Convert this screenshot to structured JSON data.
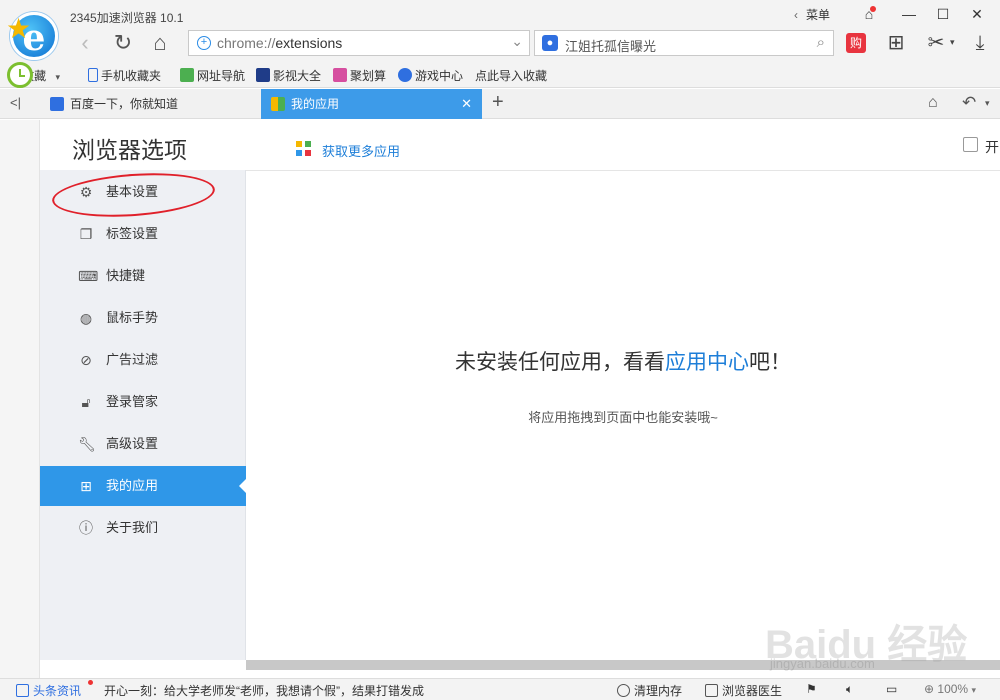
{
  "window": {
    "title": "2345加速浏览器 10.1",
    "menu_label": "菜单"
  },
  "toolbar": {
    "address_prefix": "chrome://",
    "address_path": "extensions",
    "search_text": "江姐托孤信曝光",
    "shop_badge": "购"
  },
  "bookmarks": [
    {
      "label": "收藏",
      "icon": "star-icon"
    },
    {
      "label": "手机收藏夹",
      "icon": "phone-icon"
    },
    {
      "label": "网址导航",
      "icon": "nav-icon"
    },
    {
      "label": "影视大全",
      "icon": "film-icon"
    },
    {
      "label": "聚划算",
      "icon": "deal-icon"
    },
    {
      "label": "游戏中心",
      "icon": "game-icon"
    },
    {
      "label": "点此导入收藏",
      "icon": ""
    }
  ],
  "tabs": [
    {
      "label": "百度一下，你就知道"
    },
    {
      "label": "我的应用"
    }
  ],
  "settings": {
    "title": "浏览器选项",
    "items": [
      {
        "label": "基本设置",
        "icon": "gear-icon"
      },
      {
        "label": "标签设置",
        "icon": "tabs-icon"
      },
      {
        "label": "快捷键",
        "icon": "keyboard-icon"
      },
      {
        "label": "鼠标手势",
        "icon": "mouse-icon"
      },
      {
        "label": "广告过滤",
        "icon": "block-icon"
      },
      {
        "label": "登录管家",
        "icon": "lock-icon"
      },
      {
        "label": "高级设置",
        "icon": "wrench-icon"
      },
      {
        "label": "我的应用",
        "icon": "apps-icon"
      },
      {
        "label": "关于我们",
        "icon": "info-icon"
      }
    ],
    "active_index": 7
  },
  "main": {
    "get_more": "获取更多应用",
    "checkbox_label": "开",
    "empty_prefix": "未安装任何应用，看看",
    "empty_link": "应用中心",
    "empty_suffix": "吧！",
    "empty_sub": "将应用拖拽到页面中也能安装哦~"
  },
  "status": {
    "news": "头条资讯",
    "ticker": "开心一刻：给大学老师发“老师，我想请个假”，结果打错发成",
    "clean": "清理内存",
    "doctor": "浏览器医生",
    "zoom": "100%"
  },
  "watermark": {
    "logo": "Baidu 经验",
    "url": "jingyan.baidu.com"
  },
  "colors": {
    "accent": "#2f97e8",
    "link": "#1d7ed8",
    "highlight_ellipse": "#e0202a"
  }
}
